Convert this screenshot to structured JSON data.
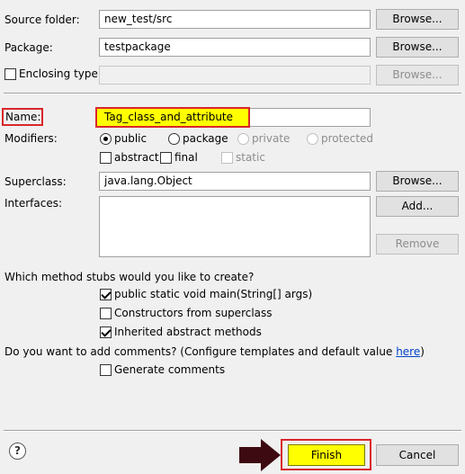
{
  "form": {
    "source_folder_label": "Source folder:",
    "source_folder_value": "new_test/src",
    "package_label": "Package:",
    "package_value": "testpackage",
    "enclosing_type_label": "Enclosing type:",
    "browse_label": "Browse...",
    "name_label": "Name:",
    "name_value": "Tag_class_and_attribute",
    "modifiers_label": "Modifiers:",
    "modifiers": {
      "public": "public",
      "package": "package",
      "private": "private",
      "protected": "protected",
      "abstract": "abstract",
      "final": "final",
      "static": "static"
    },
    "superclass_label": "Superclass:",
    "superclass_value": "java.lang.Object",
    "interfaces_label": "Interfaces:",
    "add_label": "Add...",
    "remove_label": "Remove",
    "stubs_question": "Which method stubs would you like to create?",
    "stubs": {
      "main": "public static void main(String[] args)",
      "constructors": "Constructors from superclass",
      "inherited": "Inherited abstract methods"
    },
    "comments_question": "Do you want to add comments? (Configure templates and default value ",
    "comments_link": "here",
    "comments_question_end": ")",
    "generate_comments": "Generate comments"
  },
  "footer": {
    "help_symbol": "?",
    "finish_label": "Finish",
    "cancel_label": "Cancel"
  },
  "colors": {
    "highlight_yellow": "#ffff00",
    "annotation_red": "#d9262b",
    "arrow": "#3d0a12"
  }
}
